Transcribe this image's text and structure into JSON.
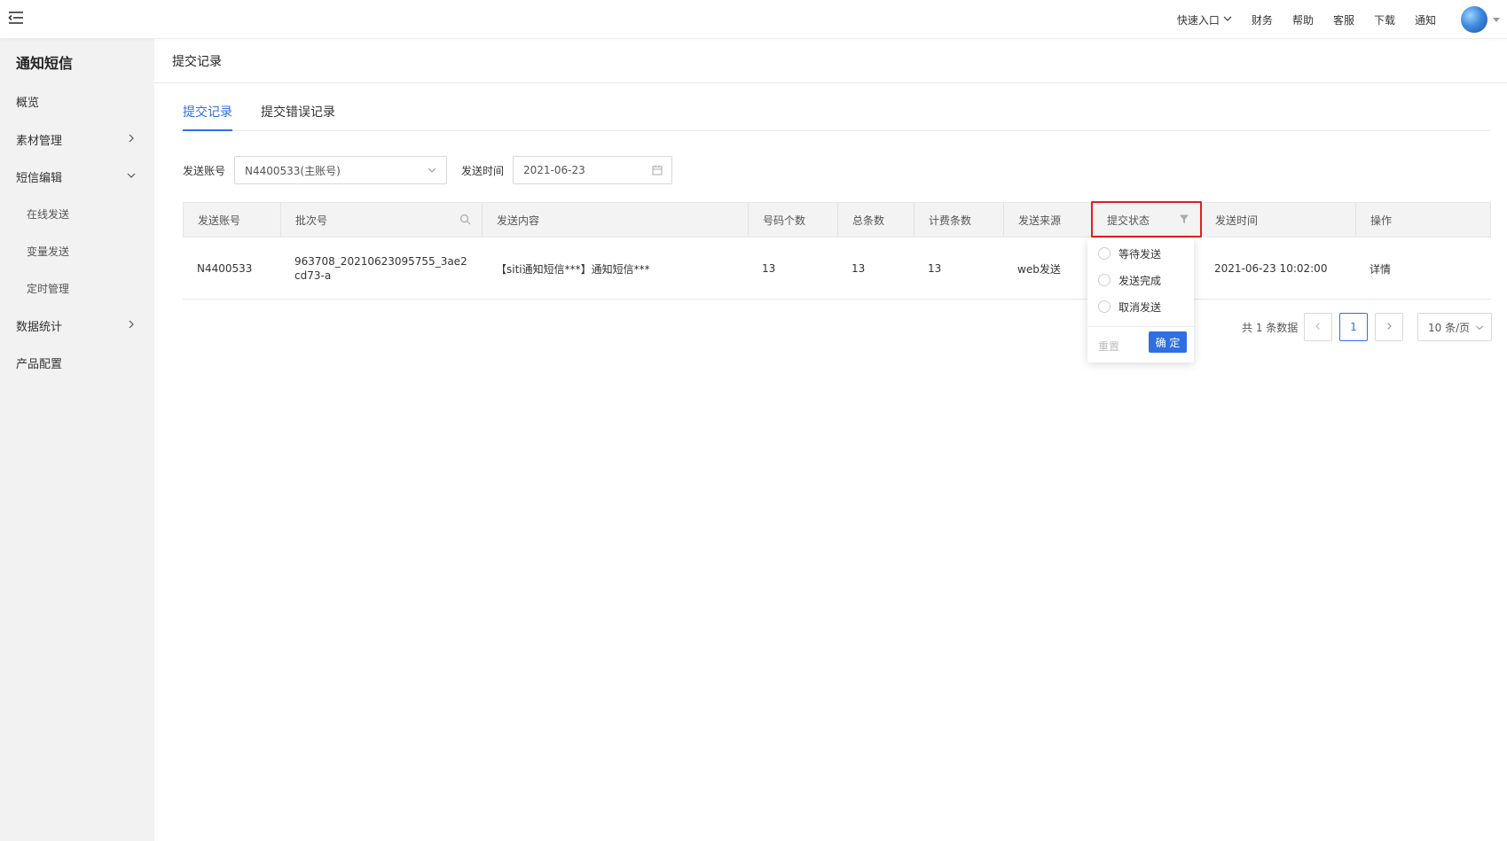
{
  "topbar": {
    "nav": [
      {
        "label": "快速入口",
        "dropdown": true
      },
      {
        "label": "财务"
      },
      {
        "label": "帮助"
      },
      {
        "label": "客服"
      },
      {
        "label": "下载"
      },
      {
        "label": "通知"
      }
    ]
  },
  "sidebar": {
    "title": "通知短信",
    "items": [
      {
        "label": "概览"
      },
      {
        "label": "素材管理"
      },
      {
        "label": "短信编辑"
      },
      {
        "label": "在线发送"
      },
      {
        "label": "变量发送"
      },
      {
        "label": "定时管理"
      },
      {
        "label": "数据统计"
      },
      {
        "label": "产品配置"
      }
    ]
  },
  "page": {
    "title": "提交记录",
    "tabs": [
      {
        "label": "提交记录",
        "active": true
      },
      {
        "label": "提交错误记录",
        "active": false
      }
    ]
  },
  "filters": {
    "account_label": "发送账号",
    "account_value": "N4400533(主账号)",
    "time_label": "发送时间",
    "time_value": "2021-06-23"
  },
  "table": {
    "columns": [
      "发送账号",
      "批次号",
      "发送内容",
      "号码个数",
      "总条数",
      "计费条数",
      "发送来源",
      "提交状态",
      "发送时间",
      "操作"
    ],
    "rows": [
      {
        "account": "N4400533",
        "batch": "963708_20210623095755_3ae2cd73-a",
        "content": "【siti通知短信***】通知短信***",
        "numbers": "13",
        "total": "13",
        "billed": "13",
        "source": "web发送",
        "status": "",
        "time": "2021-06-23 10:02:00",
        "action": "详情"
      }
    ]
  },
  "status_filter": {
    "options": [
      "等待发送",
      "发送完成",
      "取消发送"
    ],
    "reset_label": "重置",
    "confirm_label": "确 定"
  },
  "pagination": {
    "total_text": "共 1 条数据",
    "current_page": "1",
    "page_size": "10 条/页"
  },
  "colors": {
    "accent": "#2f6fe2",
    "highlight": "#e02020",
    "sidebar_bg": "#f2f2f2"
  }
}
